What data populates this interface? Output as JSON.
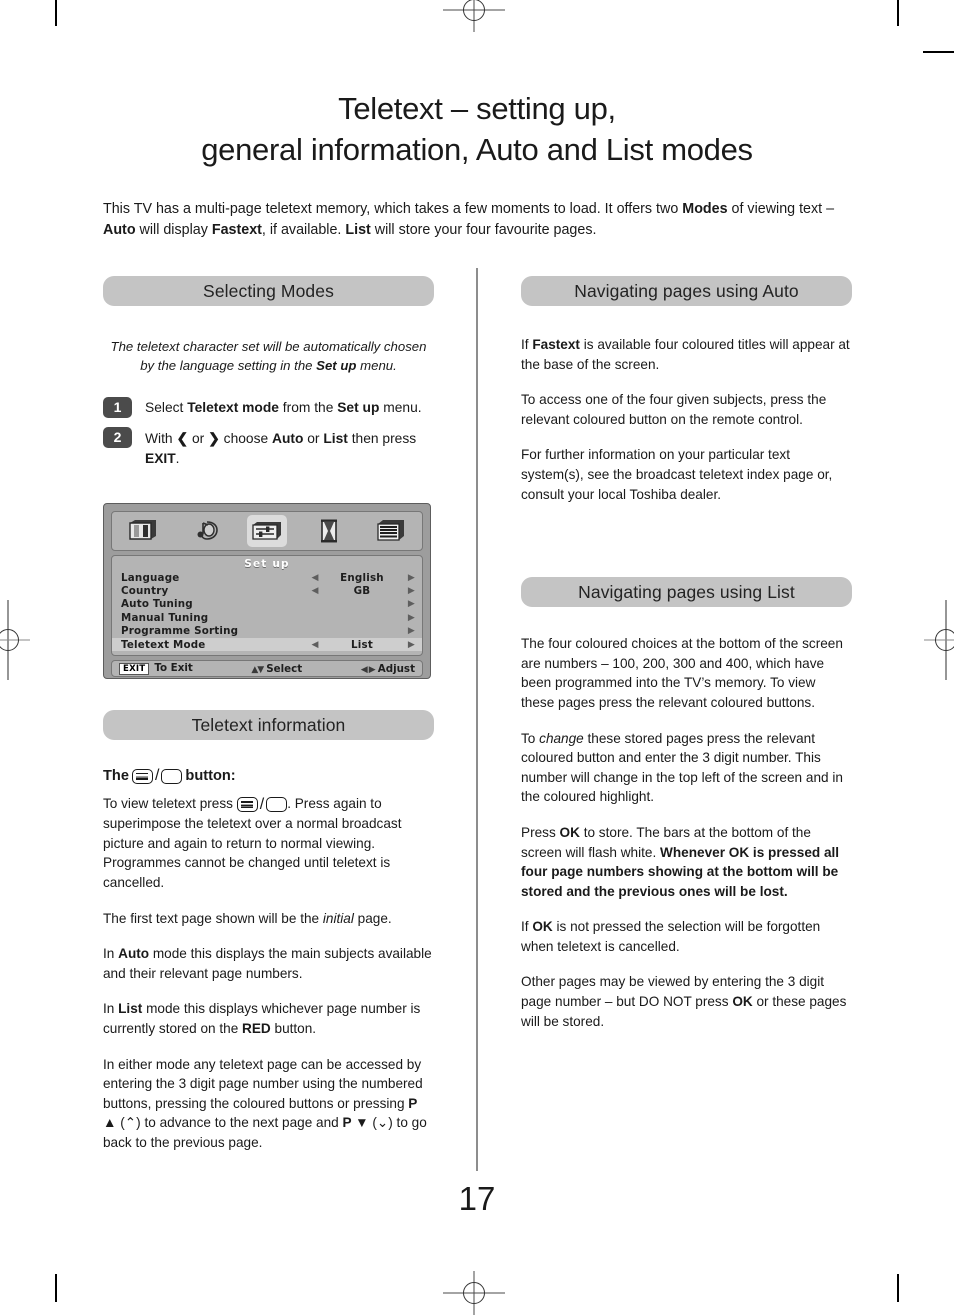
{
  "document": {
    "page_number": "17",
    "title_line1": "Teletext – setting up,",
    "title_line2": "general information, Auto and List modes",
    "intro_html": "This TV has a multi-page teletext memory, which takes a few moments to load. It offers two <b>Modes</b> of viewing text – <b>Auto</b> will display <b>Fastext</b>, if available. <b>List</b> will store your four favourite pages."
  },
  "left_column": {
    "section1": {
      "heading": "Selecting Modes",
      "note_html": "The teletext character set will be automatically chosen by the language setting in the <b>Set up</b> menu.",
      "steps": [
        {
          "number": "1",
          "text_html": "Select <b>Teletext mode</b> from the <b>Set up</b> menu."
        },
        {
          "number": "2",
          "text_html": "With <span class=\"arrowg\">❮</span> or <span class=\"arrowg\">❯</span> choose <b>Auto</b> or <b>List</b> then press <b>EXIT</b>."
        }
      ]
    },
    "osd_menu": {
      "icons": [
        "picture-icon",
        "sound-icon",
        "setup-icon",
        "timer-icon",
        "features-icon"
      ],
      "selected_icon_index": 2,
      "header": "Set up",
      "rows": [
        {
          "label": "Language",
          "value": "English",
          "left_arrow": true,
          "right_arrow": true,
          "highlighted": false
        },
        {
          "label": "Country",
          "value": "GB",
          "left_arrow": true,
          "right_arrow": true,
          "highlighted": false
        },
        {
          "label": "Auto Tuning",
          "value": "",
          "left_arrow": false,
          "right_arrow": true,
          "highlighted": false
        },
        {
          "label": "Manual Tuning",
          "value": "",
          "left_arrow": false,
          "right_arrow": true,
          "highlighted": false
        },
        {
          "label": "Programme Sorting",
          "value": "",
          "left_arrow": false,
          "right_arrow": true,
          "highlighted": false
        },
        {
          "label": "Teletext Mode",
          "value": "List",
          "left_arrow": true,
          "right_arrow": true,
          "highlighted": true
        }
      ],
      "footer": {
        "exit_chip": "EXIT",
        "exit_label": "To Exit",
        "select_arrows": "▲▼",
        "select_label": "Select",
        "adjust_arrows": "◀ ▶",
        "adjust_label": "Adjust"
      }
    },
    "section2": {
      "heading": "Teletext information",
      "subhead_before": "The",
      "subhead_after": "button:",
      "paragraphs": [
        "To view teletext press <span class=\"ttbtn\"><span class=\"ttbox lines\"></span><span class=\"ttslash\">/</span><span class=\"ttbox\"></span></span>. Press again to superimpose the teletext over a normal broadcast picture and again to return to normal viewing. Programmes cannot be changed until teletext is cancelled.",
        "The first text page shown will be the <i>initial</i> page.",
        "In <b>Auto</b> mode this displays the main subjects available and their relevant page numbers.",
        "In <b>List</b> mode this displays whichever page number is currently stored on the <b>RED</b> button.",
        "In either mode any teletext page can be accessed by entering the 3 digit page number using the numbered buttons, pressing the coloured buttons or pressing <b>P ▲</b> (⌃) to advance to the next page and <b>P ▼</b> (⌄) to go back to the previous page."
      ]
    }
  },
  "right_column": {
    "section1": {
      "heading": "Navigating pages using Auto",
      "paragraphs": [
        "If <b>Fastext</b> is available four coloured titles will appear at the base of the screen.",
        "To access one of the four given subjects, press the relevant coloured button on the remote control.",
        "For further information on your particular text system(s), see the broadcast teletext index page or, consult your local Toshiba dealer."
      ]
    },
    "section2": {
      "heading": "Navigating pages using List",
      "paragraphs": [
        "The four coloured choices at the bottom of the screen are numbers – 100, 200, 300 and 400, which have been programmed into the TV’s memory. To view these pages press the relevant coloured buttons.",
        "To <i>change</i> these stored pages press the relevant coloured button and enter the 3 digit number. This number will change in the top left of the screen and in the coloured highlight.",
        "Press <b>OK</b> to store. The bars at the bottom of the screen will flash white. <b>Whenever OK is pressed all four page numbers showing at the bottom will be stored and the previous ones will be lost.</b>",
        "If <b>OK</b> is not pressed the selection will be forgotten when teletext is cancelled.",
        "Other pages may be viewed by entering the 3 digit page number – but DO NOT press <b>OK</b> or these pages will be stored."
      ]
    }
  },
  "colors": {
    "section_bar": "#c4c4c4",
    "badge": "#4b4b4b",
    "osd_background": "#9d9d9d",
    "osd_panel": "#b4b4b4",
    "divider": "#8d8d8d"
  }
}
